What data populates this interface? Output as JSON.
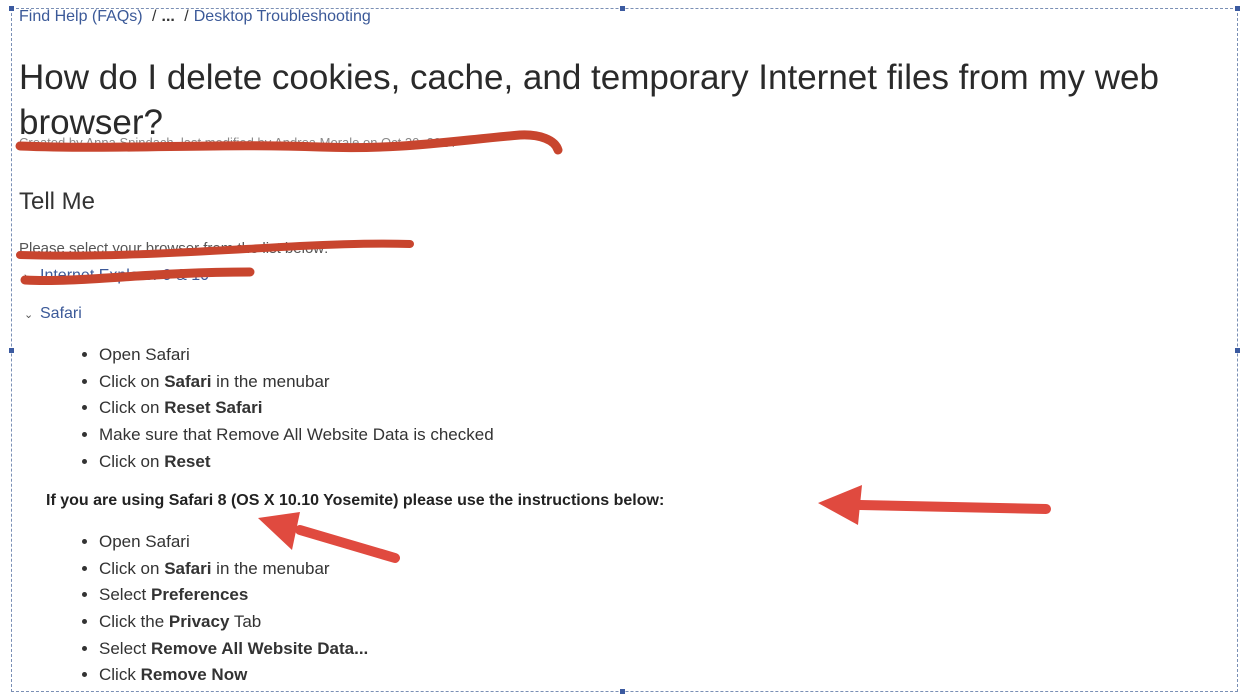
{
  "breadcrumb": {
    "parent": "Find Help (FAQs)",
    "separator": "/",
    "ellipsis": "...",
    "current": "Desktop Troubleshooting"
  },
  "article": {
    "title": "How do I delete cookies, cache, and temporary Internet files from my web browser?",
    "meta": "Created by Anna Spindach, last modified by Andrea Morale on Oct 20, 2014"
  },
  "tell_me": {
    "heading": "Tell Me",
    "intro": "Please select your browser from the list below:"
  },
  "expanders": {
    "ie": {
      "label": "Internet Explorer 9 & 10",
      "chevron": "›"
    },
    "safari": {
      "label": "Safari",
      "chevron": "⌄"
    }
  },
  "safari_steps": [
    {
      "pre": "Open Safari",
      "bold": "",
      "post": ""
    },
    {
      "pre": "Click on ",
      "bold": "Safari",
      "post": " in the menubar"
    },
    {
      "pre": "Click on ",
      "bold": "Reset Safari",
      "post": ""
    },
    {
      "pre": "Make sure that Remove All Website Data is checked",
      "bold": "",
      "post": ""
    },
    {
      "pre": "Click on ",
      "bold": "Reset",
      "post": ""
    }
  ],
  "yosemite_note": "If you are using Safari 8 (OS X 10.10 Yosemite) please use the instructions below:",
  "yosemite_steps": [
    {
      "pre": "Open Safari",
      "bold": "",
      "post": ""
    },
    {
      "pre": "Click on ",
      "bold": "Safari",
      "post": " in the menubar"
    },
    {
      "pre": "Select ",
      "bold": "Preferences",
      "post": ""
    },
    {
      "pre": "Click the ",
      "bold": "Privacy",
      "post": " Tab"
    },
    {
      "pre": "Select ",
      "bold": "Remove All Website Data...",
      "post": ""
    },
    {
      "pre": "Click ",
      "bold": "Remove Now",
      "post": ""
    }
  ],
  "colors": {
    "link": "#3b5998",
    "redaction": "#c8452e",
    "arrow": "#e04a3f"
  }
}
